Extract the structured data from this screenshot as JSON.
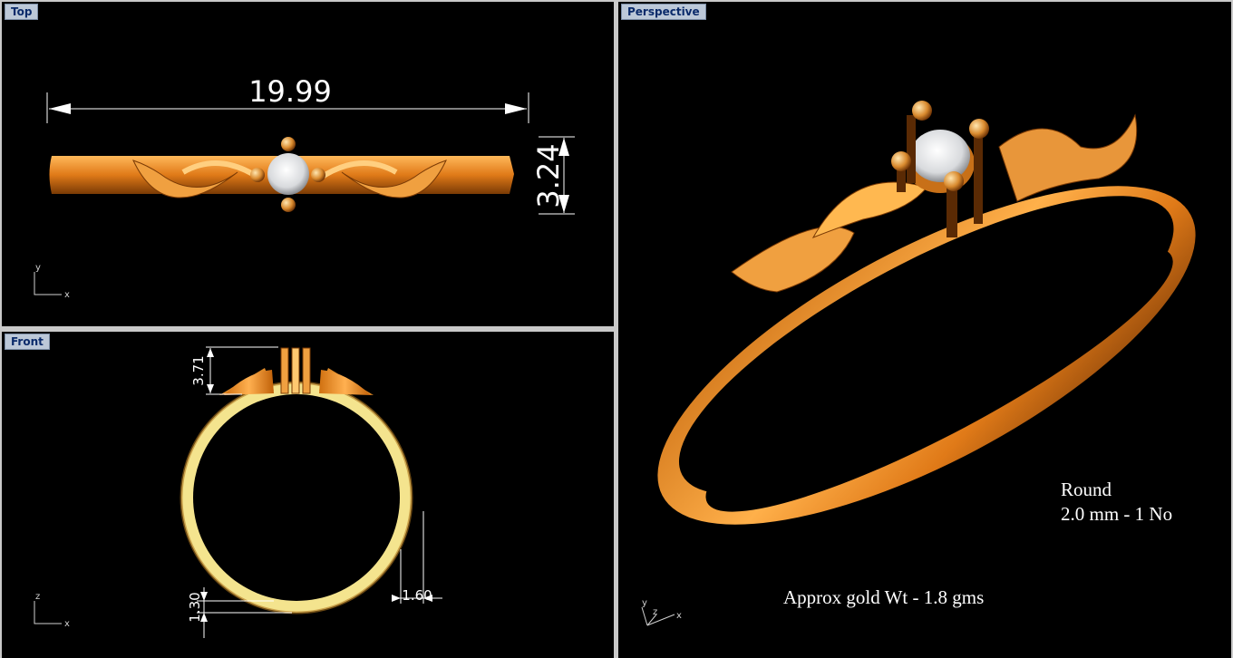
{
  "viewports": {
    "top": {
      "label": "Top",
      "dim_width": "19.99",
      "dim_height": "3.24",
      "axis_v": "y",
      "axis_h": "x"
    },
    "front": {
      "label": "Front",
      "dim_prong": "3.71",
      "dim_band_width": "1.60",
      "dim_band_thickness": "1.30",
      "axis_v": "z",
      "axis_h": "x"
    },
    "perspective": {
      "label": "Perspective",
      "axis_a": "y",
      "axis_b": "z",
      "axis_c": "x"
    }
  },
  "notes": {
    "stone_shape": "Round",
    "stone_size": "2.0 mm - 1 No",
    "gold_weight": "Approx gold Wt - 1.8 gms"
  },
  "colors": {
    "background": "#000000",
    "gold": "#e8963a",
    "inner_band": "#f6e7a0",
    "stone": "#e6e8ec",
    "frame": "#c9c9c9",
    "label_bg": "#bcc8d8"
  }
}
